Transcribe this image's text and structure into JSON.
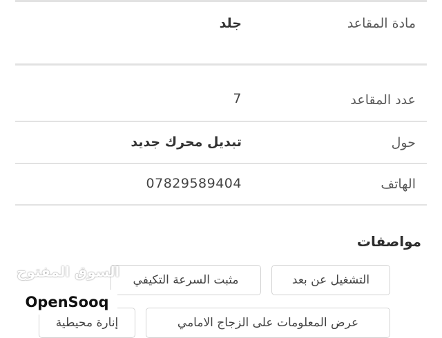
{
  "details": {
    "seat_material": {
      "label": "مادة المقاعد",
      "value": "جلد"
    },
    "seat_count": {
      "label": "عدد المقاعد",
      "value": "7"
    },
    "about": {
      "label": "حول",
      "value": "تبديل محرك جديد"
    },
    "phone": {
      "label": "الهاتف",
      "value": "07829589404"
    }
  },
  "features": {
    "title": "مواصفات",
    "items": [
      "التشغيل عن بعد",
      "مثبت السرعة التكيفي",
      "عرض المعلومات على الزجاج الامامي",
      "إنارة محيطية"
    ]
  },
  "watermark": {
    "arabic": "السوق المفتوح",
    "brand": "OpenSooq"
  },
  "colors": {
    "divider": "#e2e2e2",
    "chip_border": "#d3d3d3"
  }
}
